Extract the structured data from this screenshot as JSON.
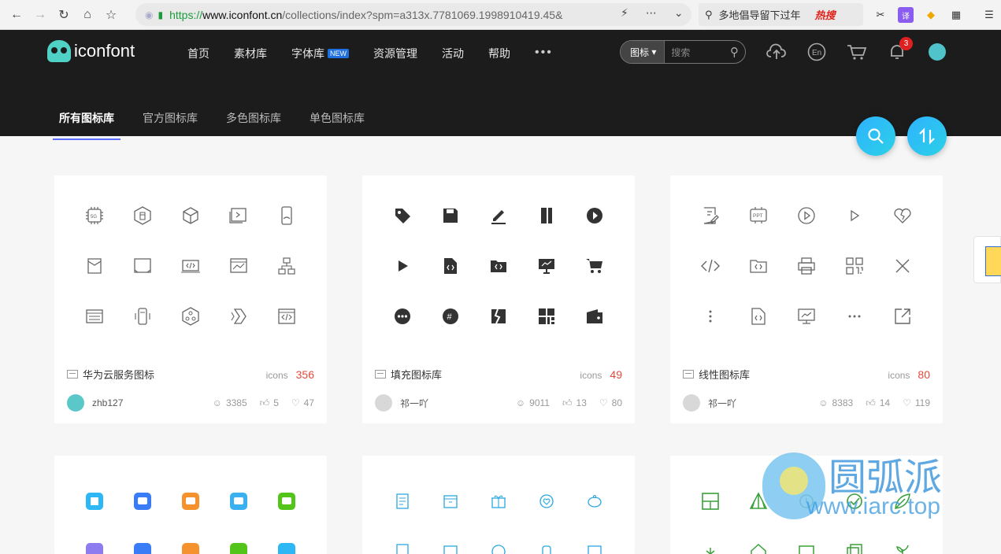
{
  "browser": {
    "url_scheme": "https://",
    "url_host": "www.iconfont.cn",
    "url_path": "/collections/index?spm=a313x.7781069.1998910419.45&",
    "search_text": "多地倡导留下过年",
    "search_badge": "热搜"
  },
  "site": {
    "logo_text": "iconfont",
    "nav": [
      "首页",
      "素材库",
      "字体库",
      "资源管理",
      "活动",
      "帮助"
    ],
    "nav_new_badge": "NEW",
    "search_select": "图标",
    "search_placeholder": "搜索",
    "notification_count": "3"
  },
  "tabs": [
    "所有图标库",
    "官方图标库",
    "多色图标库",
    "单色图标库"
  ],
  "cards": [
    {
      "title": "华为云服务图标",
      "icons_label": "icons",
      "icons_count": "356",
      "author": "zhb127",
      "users": "3385",
      "likes": "5",
      "favorites": "47"
    },
    {
      "title": "填充图标库",
      "icons_label": "icons",
      "icons_count": "49",
      "author": "祁一吖",
      "users": "9011",
      "likes": "13",
      "favorites": "80"
    },
    {
      "title": "线性图标库",
      "icons_label": "icons",
      "icons_count": "80",
      "author": "祁一吖",
      "users": "8383",
      "likes": "14",
      "favorites": "119"
    }
  ],
  "watermark": {
    "text": "圆弧派",
    "url": "www.iarc.top"
  },
  "colors": {
    "accent": "#5a6cff",
    "fab": "#2fb3ff",
    "count": "#e24a3c",
    "header_bg": "#1c1c1c"
  }
}
